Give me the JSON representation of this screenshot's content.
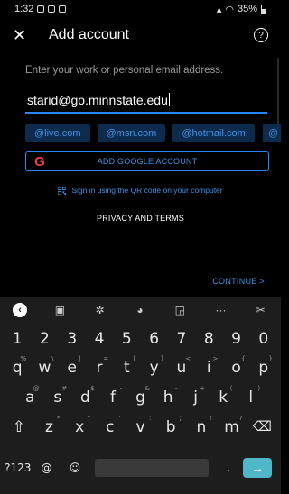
{
  "status_bar": {
    "time": "1:32",
    "battery": "35%"
  },
  "app_bar": {
    "close_icon": "close-icon",
    "title": "Add account",
    "help_icon": "help-icon",
    "help_glyph": "?"
  },
  "form": {
    "prompt": "Enter your work or personal email address.",
    "email_value": "starid@go.minnstate.edu",
    "domain_chips": [
      "@live.com",
      "@msn.com",
      "@hotmail.com",
      "@"
    ],
    "google_button_label": "ADD GOOGLE ACCOUNT",
    "qr_link": "Sign in using the QR code on your computer",
    "privacy_link": "PRIVACY AND TERMS",
    "continue_button": "CONTINUE >"
  },
  "keyboard": {
    "toolbar": [
      "back-icon",
      "clipboard-icon",
      "settings-icon",
      "palette-icon",
      "resize-icon",
      "more-icon",
      "mic-off-icon"
    ],
    "number_row": [
      "1",
      "2",
      "3",
      "4",
      "5",
      "6",
      "7",
      "8",
      "9",
      "0"
    ],
    "row1": [
      {
        "key": "q",
        "alt": "%"
      },
      {
        "key": "w",
        "alt": "\\"
      },
      {
        "key": "e",
        "alt": "|"
      },
      {
        "key": "r",
        "alt": "="
      },
      {
        "key": "t",
        "alt": "["
      },
      {
        "key": "y",
        "alt": "]"
      },
      {
        "key": "u",
        "alt": "<"
      },
      {
        "key": "i",
        "alt": ">"
      },
      {
        "key": "o",
        "alt": "{"
      },
      {
        "key": "p",
        "alt": "}"
      }
    ],
    "row2": [
      {
        "key": "a",
        "alt": "@"
      },
      {
        "key": "s",
        "alt": "#"
      },
      {
        "key": "d",
        "alt": "$"
      },
      {
        "key": "f",
        "alt": "-"
      },
      {
        "key": "g",
        "alt": "&"
      },
      {
        "key": "h",
        "alt": "-"
      },
      {
        "key": "j",
        "alt": "+"
      },
      {
        "key": "k",
        "alt": "("
      },
      {
        "key": "l",
        "alt": ")"
      }
    ],
    "row3": [
      {
        "key": "z",
        "alt": "*"
      },
      {
        "key": "x",
        "alt": "\""
      },
      {
        "key": "c",
        "alt": "'"
      },
      {
        "key": "v",
        "alt": ":"
      },
      {
        "key": "b",
        "alt": ";"
      },
      {
        "key": "n",
        "alt": "!"
      },
      {
        "key": "m",
        "alt": "?"
      }
    ],
    "symbols_key": "?123",
    "at_key": "@",
    "period_key": ".",
    "enter_glyph": "→"
  }
}
